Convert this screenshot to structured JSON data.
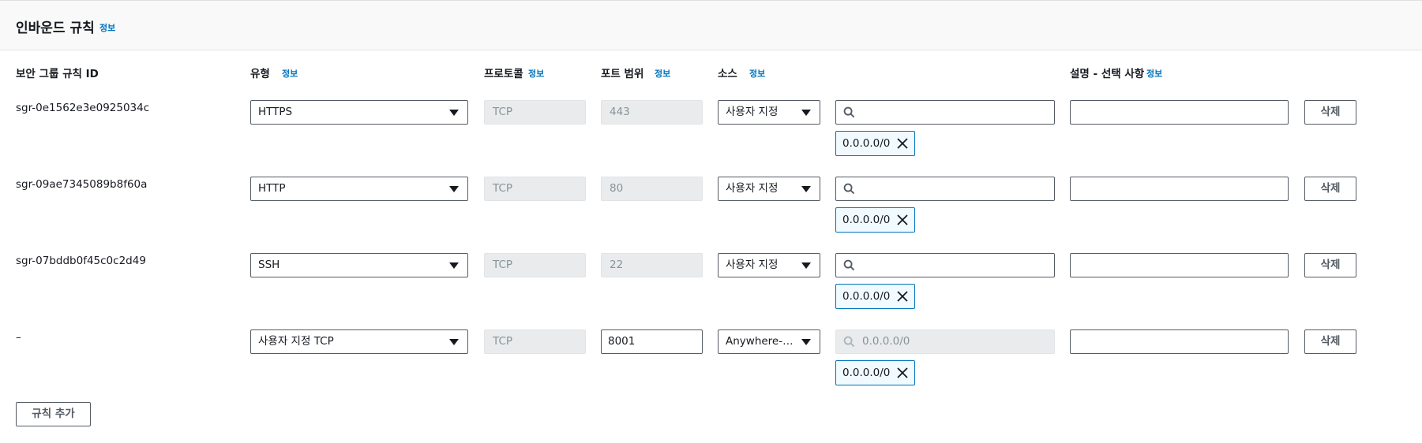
{
  "panel": {
    "title": "인바운드 규칙",
    "info": "정보"
  },
  "columns": {
    "rule_id": "보안 그룹 규칙 ID",
    "type": "유형",
    "protocol": "프로토콜",
    "port_range": "포트 범위",
    "source": "소스",
    "description": "설명 - 선택 사항",
    "info": "정보"
  },
  "rules": [
    {
      "id": "sgr-0e1562e3e0925034c",
      "type": "HTTPS",
      "protocol": "TCP",
      "port": "443",
      "source_type": "사용자 지정",
      "search_value": "",
      "token": "0.0.0.0/0",
      "description": "",
      "delete": "삭제"
    },
    {
      "id": "sgr-09ae7345089b8f60a",
      "type": "HTTP",
      "protocol": "TCP",
      "port": "80",
      "source_type": "사용자 지정",
      "search_value": "",
      "token": "0.0.0.0/0",
      "description": "",
      "delete": "삭제"
    },
    {
      "id": "sgr-07bddb0f45c0c2d49",
      "type": "SSH",
      "protocol": "TCP",
      "port": "22",
      "source_type": "사용자 지정",
      "search_value": "",
      "token": "0.0.0.0/0",
      "description": "",
      "delete": "삭제"
    },
    {
      "id": "–",
      "type": "사용자 지정 TCP",
      "protocol": "TCP",
      "port": "8001",
      "source_type": "Anywhere-…",
      "search_placeholder": "0.0.0.0/0",
      "token": "0.0.0.0/0",
      "description": "",
      "delete": "삭제"
    }
  ],
  "add_rule_button": "규칙 추가",
  "icons": {
    "search": "search-icon",
    "remove": "close-icon",
    "dropdown": "caret-down-icon"
  },
  "colors": {
    "link": "#0073bb",
    "token_border": "#0073bb",
    "token_bg": "#f1faff",
    "disabled_bg": "#e9ebed"
  }
}
